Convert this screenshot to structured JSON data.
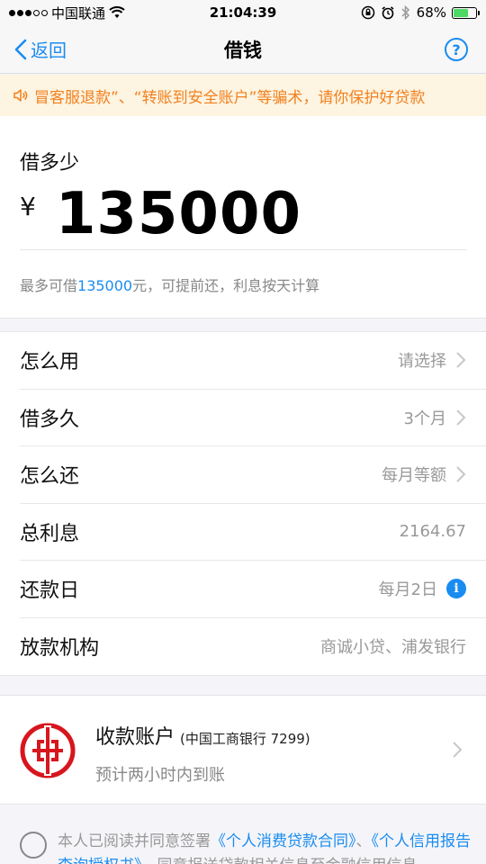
{
  "status_bar": {
    "carrier": "中国联通",
    "time": "21:04:39",
    "battery_percent": "68%",
    "battery_level": 0.68
  },
  "nav": {
    "back_label": "返回",
    "title": "借钱",
    "help_label": "?"
  },
  "notice": {
    "text": "冒客服退款”、“转账到安全账户”等骗术，请你保护好贷款"
  },
  "amount": {
    "label": "借多少",
    "currency": "¥",
    "value": "135000",
    "hint_prefix": "最多可借",
    "hint_amount": "135000",
    "hint_suffix": "元，可提前还，利息按天计算"
  },
  "rows": [
    {
      "label": "怎么用",
      "value": "请选择"
    },
    {
      "label": "借多久",
      "value": "3个月"
    },
    {
      "label": "怎么还",
      "value": "每月等额"
    },
    {
      "label": "总利息",
      "value": "2164.67"
    },
    {
      "label": "还款日",
      "value": "每月2日"
    },
    {
      "label": "放款机构",
      "value": "商诚小贷、浦发银行"
    }
  ],
  "account": {
    "title": "收款账户",
    "bank": "(中国工商银行 7299)",
    "desc": "预计两小时内到账"
  },
  "agreement": {
    "prefix": "本人已阅读并同意签署",
    "link1": "《个人消费贷款合同》",
    "sep": "、",
    "link2": "《个人信用报告查询授权书》",
    "suffix": "、同意报送贷款相关信息至金融信用信息"
  },
  "colors": {
    "accent": "#1a8cf0",
    "notice_text": "#f2801e",
    "notice_bg": "#fdf4e1",
    "bank_red": "#d7161e"
  }
}
